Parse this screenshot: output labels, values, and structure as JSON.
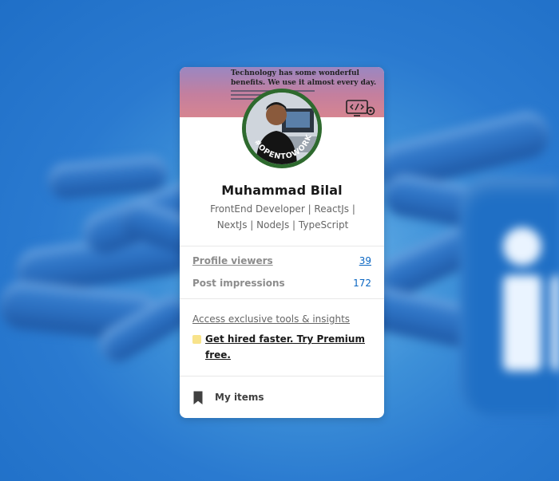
{
  "background": {
    "accent": "#2a7ad0"
  },
  "card": {
    "banner": {
      "title": "Technology has some wonderful benefits. We use it almost every day.",
      "subtitle_icon": "code-gear-icon"
    },
    "avatar": {
      "badge_text": "#OPENTOWORK",
      "badge_color": "#2e6a2e"
    },
    "name": "Muhammad Bilal",
    "headline": "FrontEnd Developer | ReactJs | NextJs | NodeJs | TypeScript",
    "stats": [
      {
        "label": "Profile viewers",
        "value": "39"
      },
      {
        "label": "Post impressions",
        "value": "172"
      }
    ],
    "premium": {
      "hint": "Access exclusive tools & insights",
      "cta": "Get hired faster. Try Premium free."
    },
    "my_items": {
      "label": "My items",
      "icon": "bookmark-icon"
    }
  }
}
